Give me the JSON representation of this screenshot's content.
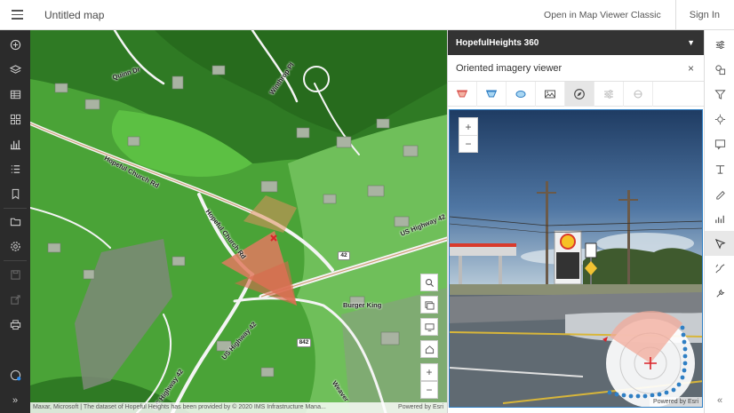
{
  "header": {
    "title": "Untitled map",
    "open_classic": "Open in Map Viewer Classic",
    "sign_in": "Sign In"
  },
  "left_toolbar": {
    "icons": [
      "add-icon",
      "layers-icon",
      "table-icon",
      "basemap-icon",
      "charts-icon",
      "legend-icon",
      "bookmarks-icon",
      "open-folder-icon",
      "settings-icon",
      "save-icon",
      "share-icon",
      "print-icon",
      "help-icon"
    ],
    "expand_label": "»"
  },
  "map": {
    "labels": {
      "quinn_dr": "Quinn Dr",
      "winthrop_pl": "Winthrop Pl",
      "hopeful_church_rd_1": "Hopeful Church Rd",
      "hopeful_church_rd_2": "Hopeful Church Rd",
      "us_highway_42_a": "US Highway 42",
      "us_highway_42_b": "US Highway 42",
      "us_highway_42_c": "US Highway 42",
      "burger_king": "Burger King",
      "weaver": "Weaver",
      "shield_42": "42",
      "shield_842": "842"
    },
    "tools": [
      "search-icon",
      "layer-list-icon",
      "screen-icon",
      "home-icon",
      "zoom-in-icon",
      "zoom-out-icon"
    ],
    "zoom_in": "+",
    "zoom_out": "−",
    "attribution": "Maxar, Microsoft | The dataset of Hopeful Heights has been provided by © 2020 IMS Infrastructure Mana...",
    "powered_by": "Powered by Esri"
  },
  "panel": {
    "layer_title": "HopefulHeights 360",
    "viewer_title": "Oriented imagery viewer",
    "close_label": "×",
    "tools": [
      "image-footprint-icon",
      "map-footprint-icon",
      "coverage-icon",
      "image-gallery-icon",
      "navigator-icon",
      "image-enhancement-icon",
      "measure-icon"
    ],
    "zoom_in": "+",
    "zoom_out": "−",
    "photo_attribution": "Powered by Esri",
    "sign_text": "42"
  },
  "right_toolbar": {
    "icons": [
      "properties-icon",
      "styles-icon",
      "filter-icon",
      "effects-icon",
      "popups-icon",
      "labels-icon",
      "configure-icon",
      "analysis-icon",
      "oriented-imagery-icon",
      "sketch-icon",
      "tools-icon"
    ],
    "collapse_label": "«"
  },
  "colors": {
    "header_bg": "#ffffff",
    "toolbar_dark": "#2b2b2b",
    "panel_head": "#333333",
    "photo_border": "#2f7fc4",
    "footprint": "#e07a5f",
    "map_green": "#48a336"
  }
}
